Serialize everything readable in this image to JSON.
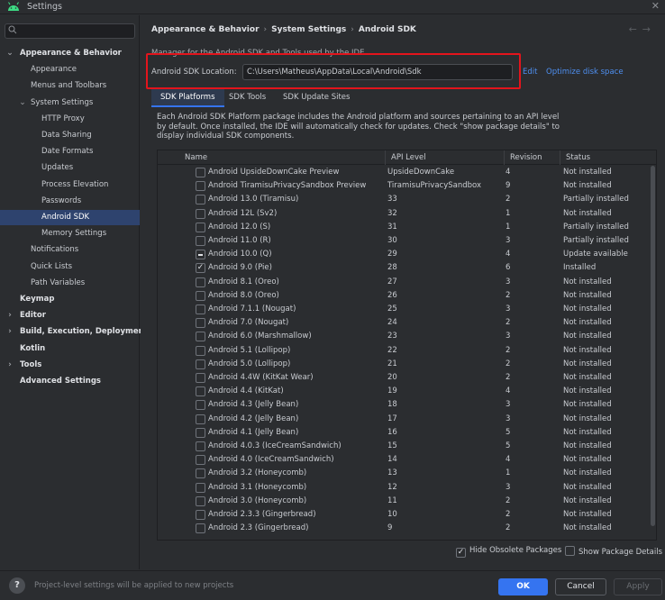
{
  "window": {
    "title": "Settings"
  },
  "search": {
    "placeholder": ""
  },
  "sidebar": {
    "items": [
      {
        "label": "Appearance & Behavior",
        "level": 0,
        "expanded": true,
        "bold": true,
        "selected": false
      },
      {
        "label": "Appearance",
        "level": 1,
        "bold": false,
        "selected": false
      },
      {
        "label": "Menus and Toolbars",
        "level": 1,
        "bold": false,
        "selected": false
      },
      {
        "label": "System Settings",
        "level": 1,
        "expanded": true,
        "bold": false,
        "selected": false
      },
      {
        "label": "HTTP Proxy",
        "level": 2,
        "bold": false,
        "selected": false
      },
      {
        "label": "Data Sharing",
        "level": 2,
        "bold": false,
        "selected": false
      },
      {
        "label": "Date Formats",
        "level": 2,
        "bold": false,
        "selected": false
      },
      {
        "label": "Updates",
        "level": 2,
        "bold": false,
        "selected": false
      },
      {
        "label": "Process Elevation",
        "level": 2,
        "bold": false,
        "selected": false
      },
      {
        "label": "Passwords",
        "level": 2,
        "bold": false,
        "selected": false
      },
      {
        "label": "Android SDK",
        "level": 2,
        "bold": false,
        "selected": true
      },
      {
        "label": "Memory Settings",
        "level": 2,
        "bold": false,
        "selected": false
      },
      {
        "label": "Notifications",
        "level": 1,
        "bold": false,
        "selected": false
      },
      {
        "label": "Quick Lists",
        "level": 1,
        "bold": false,
        "selected": false
      },
      {
        "label": "Path Variables",
        "level": 1,
        "bold": false,
        "selected": false
      },
      {
        "label": "Keymap",
        "level": 0,
        "bold": true,
        "selected": false
      },
      {
        "label": "Editor",
        "level": 0,
        "expanded": false,
        "bold": true,
        "selected": false
      },
      {
        "label": "Build, Execution, Deployment",
        "level": 0,
        "expanded": false,
        "bold": true,
        "selected": false
      },
      {
        "label": "Kotlin",
        "level": 0,
        "bold": true,
        "selected": false
      },
      {
        "label": "Tools",
        "level": 0,
        "expanded": false,
        "bold": true,
        "selected": false
      },
      {
        "label": "Advanced Settings",
        "level": 0,
        "bold": true,
        "selected": false
      }
    ]
  },
  "breadcrumb": {
    "part1": "Appearance & Behavior",
    "sep": "›",
    "part2": "System Settings",
    "part3": "Android SDK"
  },
  "nav": {
    "back": "←",
    "forward": "→"
  },
  "manager_text": "Manager for the Android SDK and Tools used by the IDE",
  "sdk_location": {
    "label": "Android SDK Location:",
    "value": "C:\\Users\\Matheus\\AppData\\Local\\Android\\Sdk",
    "edit": "Edit",
    "optimize": "Optimize disk space"
  },
  "tabs": [
    {
      "label": "SDK Platforms",
      "active": true
    },
    {
      "label": "SDK Tools",
      "active": false
    },
    {
      "label": "SDK Update Sites",
      "active": false
    }
  ],
  "description": "Each Android SDK Platform package includes the Android platform and sources pertaining to an API level by default. Once installed, the IDE will automatically check for updates. Check \"show package details\" to display individual SDK components.",
  "table": {
    "columns": [
      "Name",
      "API Level",
      "Revision",
      "Status"
    ],
    "rows": [
      {
        "check": "none",
        "name": "Android UpsideDownCake Preview",
        "api": "UpsideDownCake",
        "rev": "4",
        "status": "Not installed"
      },
      {
        "check": "none",
        "name": "Android TiramisuPrivacySandbox Preview",
        "api": "TiramisuPrivacySandbox",
        "rev": "9",
        "status": "Not installed"
      },
      {
        "check": "none",
        "name": "Android 13.0 (Tiramisu)",
        "api": "33",
        "rev": "2",
        "status": "Partially installed"
      },
      {
        "check": "none",
        "name": "Android 12L (Sv2)",
        "api": "32",
        "rev": "1",
        "status": "Not installed"
      },
      {
        "check": "none",
        "name": "Android 12.0 (S)",
        "api": "31",
        "rev": "1",
        "status": "Partially installed"
      },
      {
        "check": "none",
        "name": "Android 11.0 (R)",
        "api": "30",
        "rev": "3",
        "status": "Partially installed"
      },
      {
        "check": "partial",
        "name": "Android 10.0 (Q)",
        "api": "29",
        "rev": "4",
        "status": "Update available"
      },
      {
        "check": "checked",
        "name": "Android 9.0 (Pie)",
        "api": "28",
        "rev": "6",
        "status": "Installed"
      },
      {
        "check": "none",
        "name": "Android 8.1 (Oreo)",
        "api": "27",
        "rev": "3",
        "status": "Not installed"
      },
      {
        "check": "none",
        "name": "Android 8.0 (Oreo)",
        "api": "26",
        "rev": "2",
        "status": "Not installed"
      },
      {
        "check": "none",
        "name": "Android 7.1.1 (Nougat)",
        "api": "25",
        "rev": "3",
        "status": "Not installed"
      },
      {
        "check": "none",
        "name": "Android 7.0 (Nougat)",
        "api": "24",
        "rev": "2",
        "status": "Not installed"
      },
      {
        "check": "none",
        "name": "Android 6.0 (Marshmallow)",
        "api": "23",
        "rev": "3",
        "status": "Not installed"
      },
      {
        "check": "none",
        "name": "Android 5.1 (Lollipop)",
        "api": "22",
        "rev": "2",
        "status": "Not installed"
      },
      {
        "check": "none",
        "name": "Android 5.0 (Lollipop)",
        "api": "21",
        "rev": "2",
        "status": "Not installed"
      },
      {
        "check": "none",
        "name": "Android 4.4W (KitKat Wear)",
        "api": "20",
        "rev": "2",
        "status": "Not installed"
      },
      {
        "check": "none",
        "name": "Android 4.4 (KitKat)",
        "api": "19",
        "rev": "4",
        "status": "Not installed"
      },
      {
        "check": "none",
        "name": "Android 4.3 (Jelly Bean)",
        "api": "18",
        "rev": "3",
        "status": "Not installed"
      },
      {
        "check": "none",
        "name": "Android 4.2 (Jelly Bean)",
        "api": "17",
        "rev": "3",
        "status": "Not installed"
      },
      {
        "check": "none",
        "name": "Android 4.1 (Jelly Bean)",
        "api": "16",
        "rev": "5",
        "status": "Not installed"
      },
      {
        "check": "none",
        "name": "Android 4.0.3 (IceCreamSandwich)",
        "api": "15",
        "rev": "5",
        "status": "Not installed"
      },
      {
        "check": "none",
        "name": "Android 4.0 (IceCreamSandwich)",
        "api": "14",
        "rev": "4",
        "status": "Not installed"
      },
      {
        "check": "none",
        "name": "Android 3.2 (Honeycomb)",
        "api": "13",
        "rev": "1",
        "status": "Not installed"
      },
      {
        "check": "none",
        "name": "Android 3.1 (Honeycomb)",
        "api": "12",
        "rev": "3",
        "status": "Not installed"
      },
      {
        "check": "none",
        "name": "Android 3.0 (Honeycomb)",
        "api": "11",
        "rev": "2",
        "status": "Not installed"
      },
      {
        "check": "none",
        "name": "Android 2.3.3 (Gingerbread)",
        "api": "10",
        "rev": "2",
        "status": "Not installed"
      },
      {
        "check": "none",
        "name": "Android 2.3 (Gingerbread)",
        "api": "9",
        "rev": "2",
        "status": "Not installed"
      }
    ]
  },
  "options": {
    "hide_obsolete": {
      "label": "Hide Obsolete Packages",
      "checked": true
    },
    "show_details": {
      "label": "Show Package Details",
      "checked": false
    }
  },
  "footer": {
    "help": "?",
    "note": "Project-level settings will be applied to new projects",
    "ok": "OK",
    "cancel": "Cancel",
    "apply": "Apply"
  },
  "colors": {
    "accent": "#3574f0",
    "link": "#4e8ff0",
    "highlight_box": "#e3141c",
    "selection": "#2e436e"
  }
}
